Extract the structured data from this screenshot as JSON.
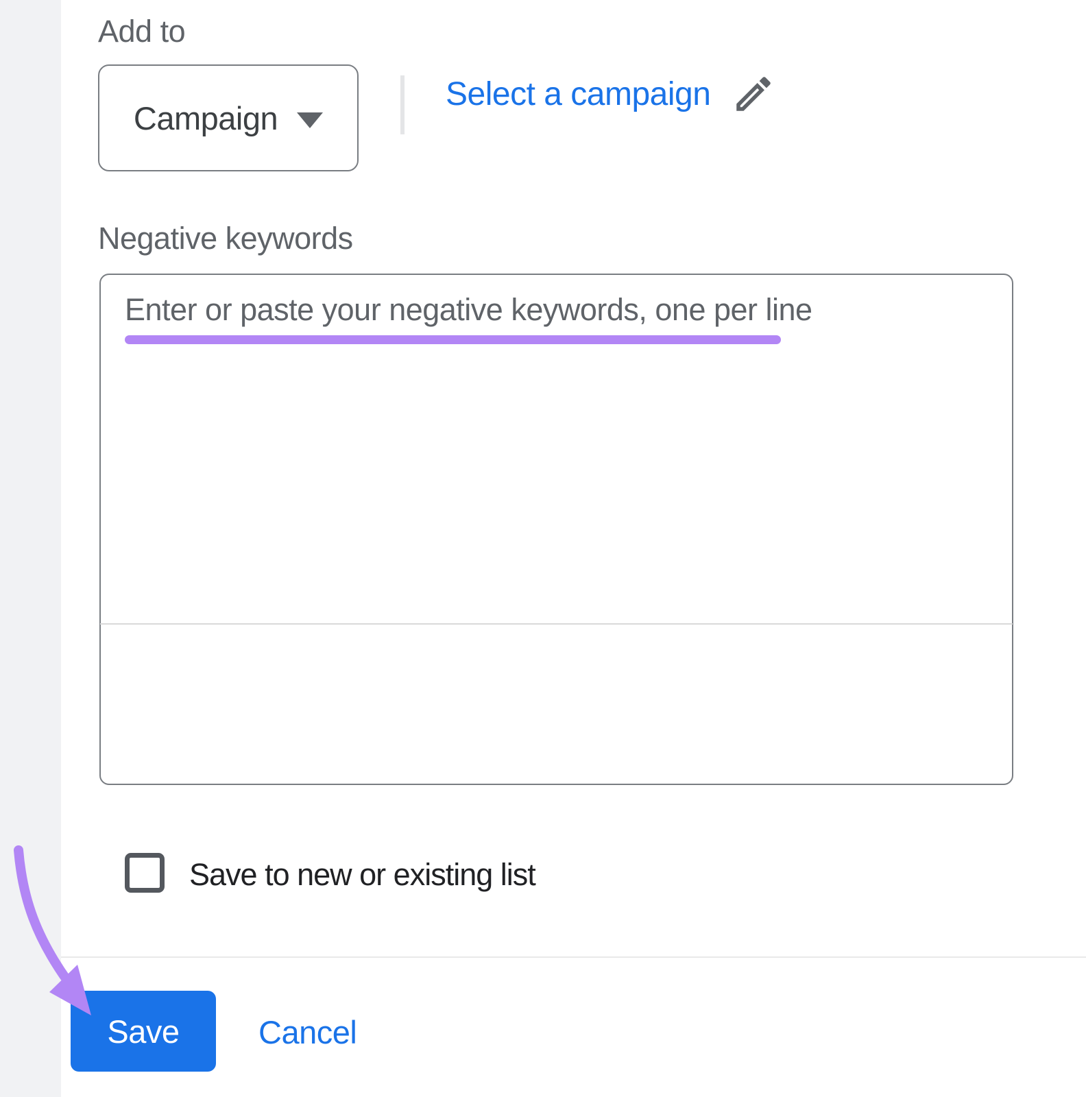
{
  "panel": {
    "add_to": {
      "label": "Add to",
      "dropdown": {
        "value": "Campaign",
        "caret_icon": "triangle-down"
      },
      "select_campaign": {
        "label": "Select a campaign",
        "edit_icon": "pencil"
      }
    },
    "negative_keywords": {
      "label": "Negative keywords",
      "placeholder": "Enter or paste your negative keywords, one per line",
      "value": ""
    },
    "save_to_list": {
      "label": "Save to new or existing list",
      "checked": false
    },
    "footer": {
      "save_label": "Save",
      "cancel_label": "Cancel"
    }
  },
  "annotations": {
    "underline_color": "#b286f5",
    "arrow_color": "#b286f5"
  },
  "colors": {
    "accent_blue": "#1a73e8",
    "label_gray": "#5f6368",
    "text_dark": "#202124",
    "border_gray": "#797d82",
    "sidebar_gray": "#f1f2f4",
    "divider_gray": "#e9e9e9"
  }
}
